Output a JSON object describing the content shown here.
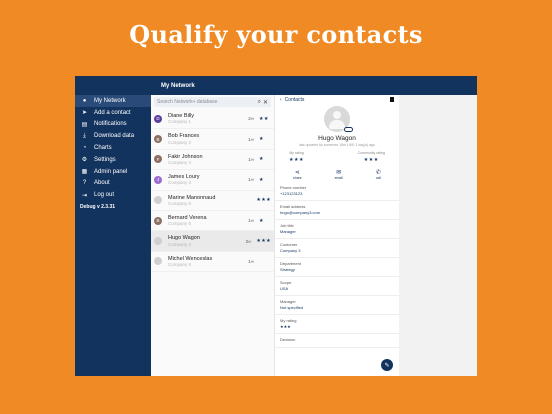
{
  "banner": "Qualify your contacts",
  "header": {
    "title": "My Network"
  },
  "sidebar": {
    "items": [
      {
        "label": "My Network",
        "icon": "person-circle-icon",
        "glyph": "●",
        "active": true
      },
      {
        "label": "Add a contact",
        "icon": "send-icon",
        "glyph": "➤"
      },
      {
        "label": "Notifications",
        "icon": "message-icon",
        "glyph": "▤"
      },
      {
        "label": "Download data",
        "icon": "download-icon",
        "glyph": "⤓"
      },
      {
        "label": "Charts",
        "icon": "chart-icon",
        "glyph": "◔"
      },
      {
        "label": "Settings",
        "icon": "gear-icon",
        "glyph": "⚙"
      },
      {
        "label": "Admin panel",
        "icon": "admin-icon",
        "glyph": "▦"
      },
      {
        "label": "About",
        "icon": "help-icon",
        "glyph": "?"
      },
      {
        "label": "Log out",
        "icon": "logout-icon",
        "glyph": "⇥"
      }
    ],
    "version": "Debug v 2.3.31"
  },
  "search": {
    "placeholder": "Search Network+ database"
  },
  "contacts": [
    {
      "name": "Diane Billy",
      "company": "Company 1",
      "count": "2",
      "stars": "★★",
      "initial": "D",
      "color": "#5b3fa0"
    },
    {
      "name": "Bob Frances",
      "company": "Company 2",
      "count": "1",
      "stars": "★",
      "initial": "B",
      "color": "#8d6e63"
    },
    {
      "name": "Fakir Johnson",
      "company": "Company 3",
      "count": "1",
      "stars": "★",
      "initial": "F",
      "color": "#8d6e63"
    },
    {
      "name": "James Loury",
      "company": "Company 4",
      "count": "1",
      "stars": "★",
      "initial": "J",
      "color": "#9c6bd0"
    },
    {
      "name": "Marine Manonnaud",
      "company": "Company 5",
      "count": "",
      "stars": "★★★",
      "initial": "",
      "color": "#cfcfcf"
    },
    {
      "name": "Bernard Verena",
      "company": "Company 6",
      "count": "1",
      "stars": "★",
      "initial": "B",
      "color": "#8d6e63"
    },
    {
      "name": "Hugo Wagon",
      "company": "Company 3",
      "count": "2",
      "stars": "★★★",
      "initial": "",
      "color": "#cfcfcf",
      "selected": true
    },
    {
      "name": "Michel Wenceslas",
      "company": "Company 8",
      "count": "1",
      "stars": "",
      "initial": "",
      "color": "#cfcfcf"
    }
  ],
  "detail": {
    "back_label": "Contacts",
    "name": "Hugo Wagon",
    "subtitle": "last updated by someone 18m LIKE 1 day(s) ago",
    "my_rating_label": "My rating",
    "my_rating_stars": "★★★",
    "community_label": "Community rating",
    "community_stars": "★★★",
    "actions": [
      {
        "label": "share",
        "icon": "share-icon",
        "glyph": "⋖"
      },
      {
        "label": "email",
        "icon": "mail-icon",
        "glyph": "✉"
      },
      {
        "label": "call",
        "icon": "phone-icon",
        "glyph": "✆"
      }
    ],
    "fields": [
      {
        "label": "Phone number",
        "value": "+123123123"
      },
      {
        "label": "Email address",
        "value": "hugo@company3.com"
      },
      {
        "label": "Job title",
        "value": "Manager"
      },
      {
        "label": "Customer",
        "value": "Company 3"
      },
      {
        "label": "Department",
        "value": "Strategy"
      },
      {
        "label": "Scope",
        "value": "USA"
      },
      {
        "label": "Manager",
        "value": "Not specified"
      },
      {
        "label": "My rating",
        "value": "★★★"
      },
      {
        "label": "Decision",
        "value": ""
      }
    ],
    "fab_icon": "edit-icon"
  }
}
